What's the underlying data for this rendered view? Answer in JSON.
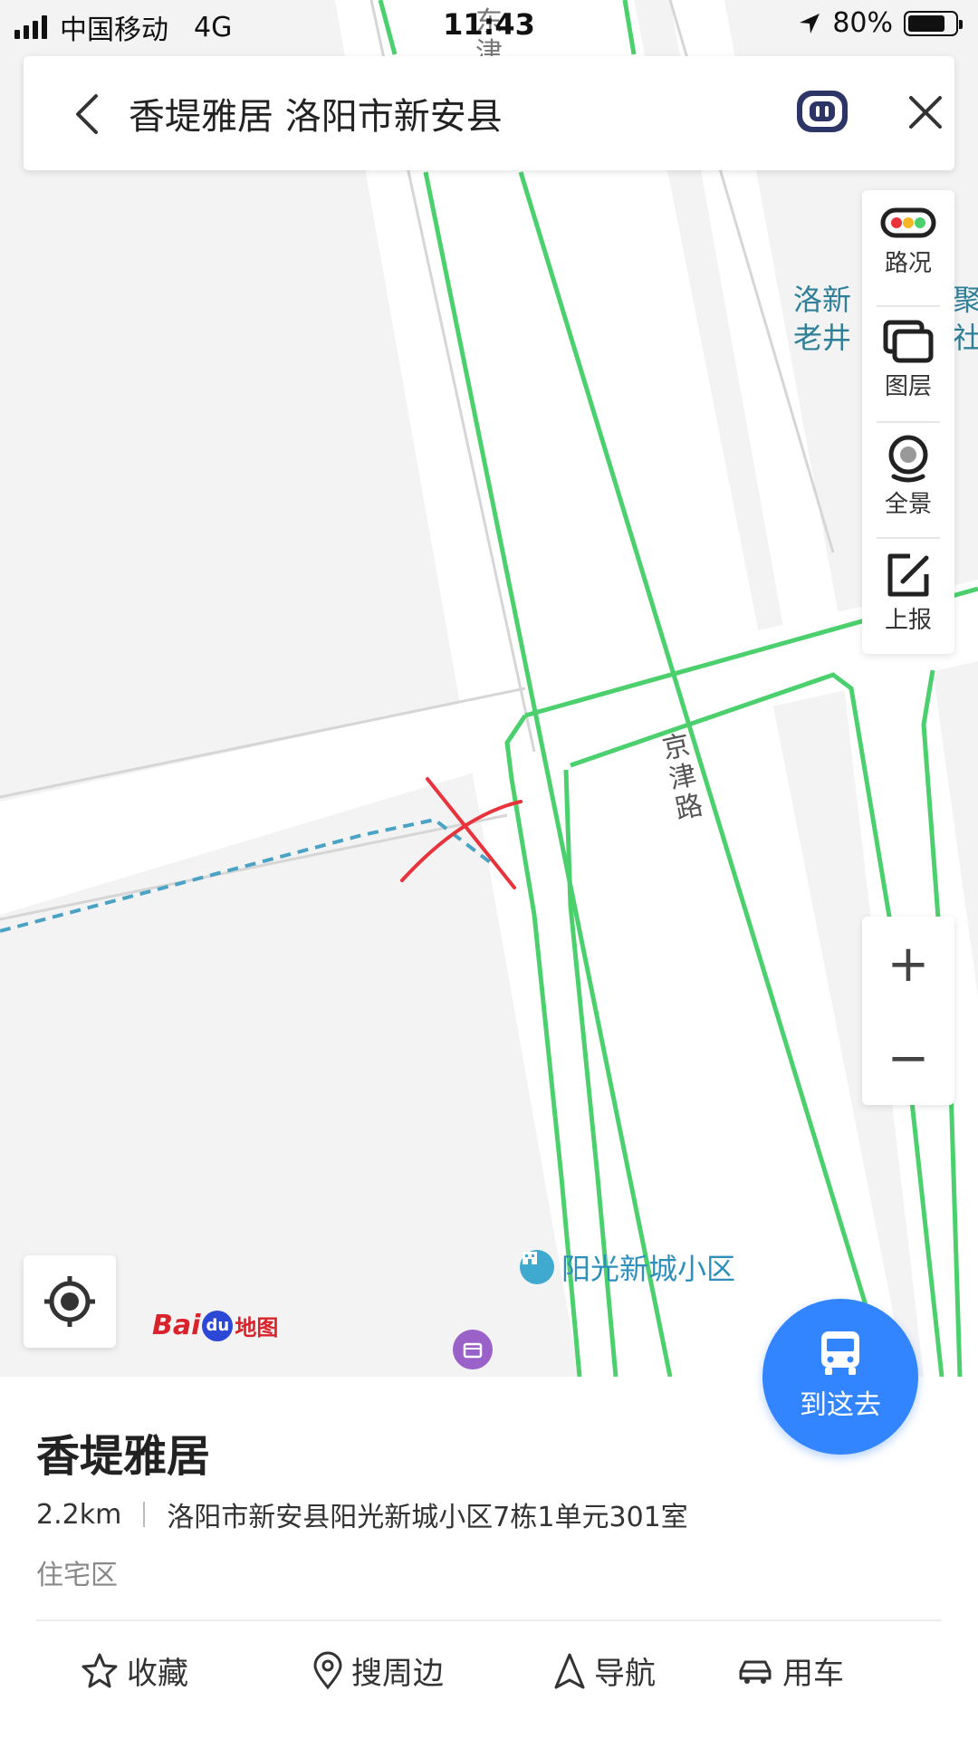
{
  "status_bar": {
    "carrier": "中国移动",
    "network": "4G",
    "time": "11:43",
    "battery_percent": "80%",
    "battery_level": 0.8
  },
  "search": {
    "query": "香堤雅居 洛阳市新安县"
  },
  "toolbar": {
    "traffic_label": "路况",
    "layers_label": "图层",
    "panorama_label": "全景",
    "report_label": "上报"
  },
  "map": {
    "area_label_line1": "洛新",
    "area_label_line2": "老井",
    "area_label_right1": "聚",
    "area_label_right2": "社",
    "road_label_chars": [
      "京",
      "津",
      "路"
    ],
    "top_road_chars": [
      "东",
      "津"
    ],
    "poi_name": "阳光新城小区",
    "brand_bai": "Bai",
    "brand_du": "du",
    "brand_map": "地图",
    "road_color": "#4cd06e",
    "dashed_line_color": "#4aa3c4",
    "marker_color": "#e8323c"
  },
  "zoom": {
    "in": "+",
    "out": "−"
  },
  "go_button": {
    "label": "到这去",
    "color": "#3385ff"
  },
  "place": {
    "name": "香堤雅居",
    "distance": "2.2km",
    "address": "洛阳市新安县阳光新城小区7栋1单元301室",
    "type": "住宅区"
  },
  "actions": {
    "favorite": "收藏",
    "nearby": "搜周边",
    "navigate": "导航",
    "ride": "用车"
  }
}
